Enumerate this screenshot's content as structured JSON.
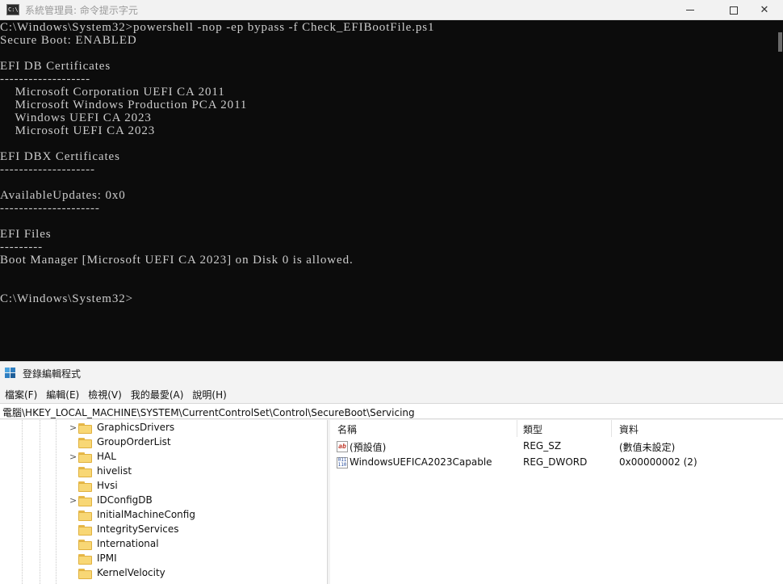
{
  "cmd": {
    "title": "系統管理員: 命令提示字元",
    "icon": "cmd-icon",
    "icon_text": "C:\\.",
    "lines": [
      "C:\\Windows\\System32>powershell -nop -ep bypass -f Check_EFIBootFile.ps1",
      "Secure Boot: ENABLED",
      "",
      "EFI DB Certificates",
      "-------------------",
      "    Microsoft Corporation UEFI CA 2011",
      "    Microsoft Windows Production PCA 2011",
      "    Windows UEFI CA 2023",
      "    Microsoft UEFI CA 2023",
      "",
      "EFI DBX Certificates",
      "--------------------",
      "",
      "AvailableUpdates: 0x0",
      "---------------------",
      "",
      "EFI Files",
      "---------",
      "Boot Manager [Microsoft UEFI CA 2023] on Disk 0 is allowed.",
      "",
      "",
      "C:\\Windows\\System32>"
    ],
    "colors": {
      "background": "#0c0c0c",
      "text": "#cccccc"
    }
  },
  "regedit": {
    "title": "登錄編輯程式",
    "menu": [
      "檔案(F)",
      "編輯(E)",
      "檢視(V)",
      "我的最愛(A)",
      "說明(H)"
    ],
    "address": "電腦\\HKEY_LOCAL_MACHINE\\SYSTEM\\CurrentControlSet\\Control\\SecureBoot\\Servicing",
    "tree": [
      {
        "label": "GraphicsDrivers",
        "expandable": true
      },
      {
        "label": "GroupOrderList",
        "expandable": false
      },
      {
        "label": "HAL",
        "expandable": true
      },
      {
        "label": "hivelist",
        "expandable": false
      },
      {
        "label": "Hvsi",
        "expandable": false
      },
      {
        "label": "IDConfigDB",
        "expandable": true
      },
      {
        "label": "InitialMachineConfig",
        "expandable": false
      },
      {
        "label": "IntegrityServices",
        "expandable": false
      },
      {
        "label": "International",
        "expandable": false
      },
      {
        "label": "IPMI",
        "expandable": false
      },
      {
        "label": "KernelVelocity",
        "expandable": false
      }
    ],
    "columns": {
      "name": "名稱",
      "type": "類型",
      "data": "資料"
    },
    "values": [
      {
        "icon": "string-value-icon",
        "name": "(預設值)",
        "type": "REG_SZ",
        "data": "(數值未設定)"
      },
      {
        "icon": "dword-value-icon",
        "name": "WindowsUEFICA2023Capable",
        "type": "REG_DWORD",
        "data": "0x00000002 (2)"
      }
    ]
  }
}
